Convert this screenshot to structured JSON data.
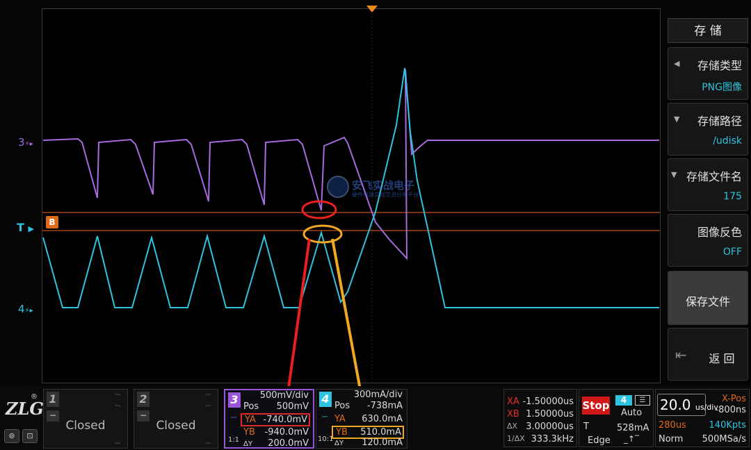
{
  "waveform": {
    "ch3_marker": "3",
    "ch4_marker": "4",
    "trigger_marker": "T",
    "cursor_b_badge": "B",
    "watermark_text": "安飞实战电子",
    "watermark_subtext": "硬件电路实战交流分享平台"
  },
  "menu": {
    "title": "存 储",
    "items": [
      {
        "label": "存储类型",
        "value": "PNG图像"
      },
      {
        "label": "存储路径",
        "value": "/udisk"
      },
      {
        "label": "存储文件名",
        "value": "175"
      },
      {
        "label": "图像反色",
        "value": "OFF"
      },
      {
        "label": "保存文件",
        "value": ""
      },
      {
        "label": "返 回",
        "value": ""
      }
    ]
  },
  "bottom": {
    "logo": "ZLG",
    "logo_mark": "®",
    "ch1": {
      "num": "1",
      "dash": "--",
      "status": "Closed"
    },
    "ch2": {
      "num": "2",
      "dash": "--",
      "status": "Closed"
    },
    "ch3": {
      "num": "3",
      "scale": "500mV/div",
      "pos_label": "Pos",
      "pos_value": "500mV",
      "ya_label": "YA",
      "ya_value": "-740.0mV",
      "yb_label": "YB",
      "yb_value": "-940.0mV",
      "dy_label": "ΔY",
      "dy_value": "200.0mV",
      "coupling": "1:1"
    },
    "ch4": {
      "num": "4",
      "scale": "300mA/div",
      "pos_label": "Pos",
      "pos_value": "-738mA",
      "ya_label": "YA",
      "ya_value": "630.0mA",
      "yb_label": "YB",
      "yb_value": "510.0mA",
      "dy_label": "ΔY",
      "dy_value": "120.0mA",
      "coupling": "10:1"
    },
    "cursors": {
      "xa_label": "XA",
      "xa_value": "-1.50000us",
      "xb_label": "XB",
      "xb_value": "1.50000us",
      "dx_label": "ΔX",
      "dx_value": "3.00000us",
      "inv_label": "1/ΔX",
      "inv_value": "333.3kHz"
    },
    "trigger": {
      "state": "Stop",
      "channel": "4",
      "mode": "Auto",
      "type_label": "T",
      "level": "528mA",
      "edge": "Edge"
    },
    "timebase": {
      "value": "20.0",
      "unit": "us/div",
      "xpos_label": "X-Pos",
      "xpos_value": "-800ns",
      "delay": "280us",
      "mem": "140Kpts",
      "acq": "Norm",
      "rate": "500MSa/s"
    }
  },
  "colors": {
    "ch3": "#9a55d8",
    "ch4": "#2ec4e0",
    "cursor": "#e06a1a",
    "stop": "#d01818"
  }
}
